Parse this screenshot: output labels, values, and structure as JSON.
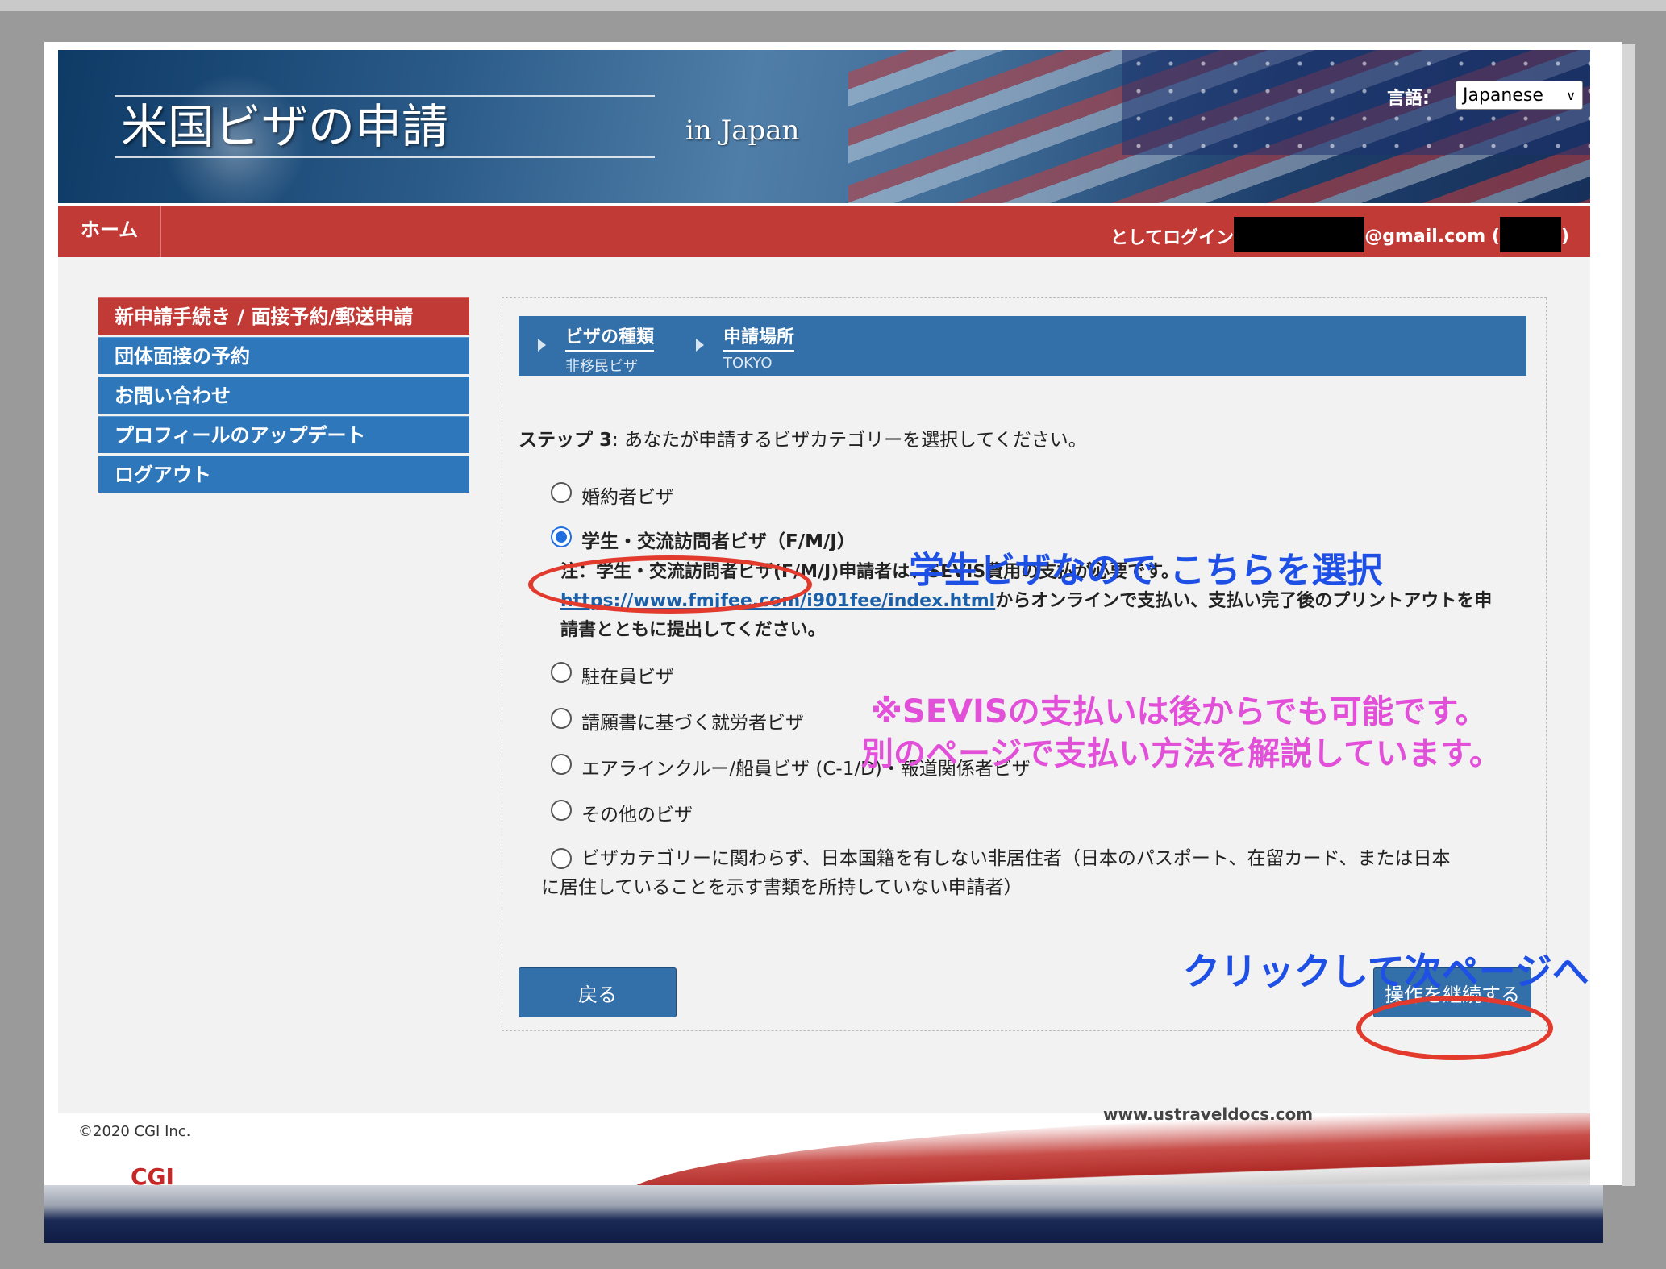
{
  "header": {
    "title": "米国ビザの申請",
    "subtitle": "in  Japan",
    "language_label": "言語:",
    "language_value": "Japanese"
  },
  "nav": {
    "home": "ホーム",
    "login_prefix": "としてログイン",
    "login_email_suffix": "@gmail.com (",
    "login_suffix": ")"
  },
  "sidebar": {
    "items": [
      {
        "label": "新申請手続き / 面接予約/郵送申請"
      },
      {
        "label": "団体面接の予約"
      },
      {
        "label": "お問い合わせ"
      },
      {
        "label": "プロフィールのアップデート"
      },
      {
        "label": "ログアウト"
      }
    ]
  },
  "steps": [
    {
      "title": "ビザの種類",
      "value": "非移民ビザ"
    },
    {
      "title": "申請場所",
      "value": "TOKYO"
    }
  ],
  "question": {
    "step_label": "ステップ 3",
    "text": ": あなたが申請するビザカテゴリーを選択してください。"
  },
  "options": {
    "fiance": "婚約者ビザ",
    "student": "学生・交流訪問者ビザ（F/M/J）",
    "note_line1": "注：学生・交流訪問者ビザ(F/M/J)申請者は、SEVIS費用の支払が必要です。",
    "note_link": "https://www.fmjfee.com/i901fee/index.html",
    "note_line2": "からオンラインで支払い、支払い完了後のプリントアウトを申",
    "note_line3": "請書とともに提出してください。",
    "expat": "駐在員ビザ",
    "petition": "請願書に基づく就労者ビザ",
    "crew": "エアラインクルー/船員ビザ (C-1/D)・報道関係者ビザ",
    "other": "その他のビザ",
    "nonresident_line1": "ビザカテゴリーに関わらず、日本国籍を有しない非居住者（日本のパスポート、在留カード、または日本",
    "nonresident_line2": "に居住していることを示す書類を所持していない申請者）"
  },
  "buttons": {
    "back": "戻る",
    "continue": "操作を継続する"
  },
  "annotations": {
    "select_this": "学生ビザなので こちらを選択",
    "sevis_note_line1": "※SEVISの支払いは後からでも可能です。",
    "sevis_note_line2": "別のページで支払い方法を解説しています。",
    "click_next": "クリックして次ページへ"
  },
  "footer": {
    "logo": "CGI",
    "copyright": "©2020 CGI Inc.",
    "url": "www.ustraveldocs.com"
  },
  "colors": {
    "nav_red": "#c23a35",
    "side_blue": "#2e77bb",
    "button_blue": "#336fa8",
    "annotation_red": "#e23b2e",
    "annotation_blue": "#1f50e6",
    "annotation_pink": "#e24fd8"
  }
}
